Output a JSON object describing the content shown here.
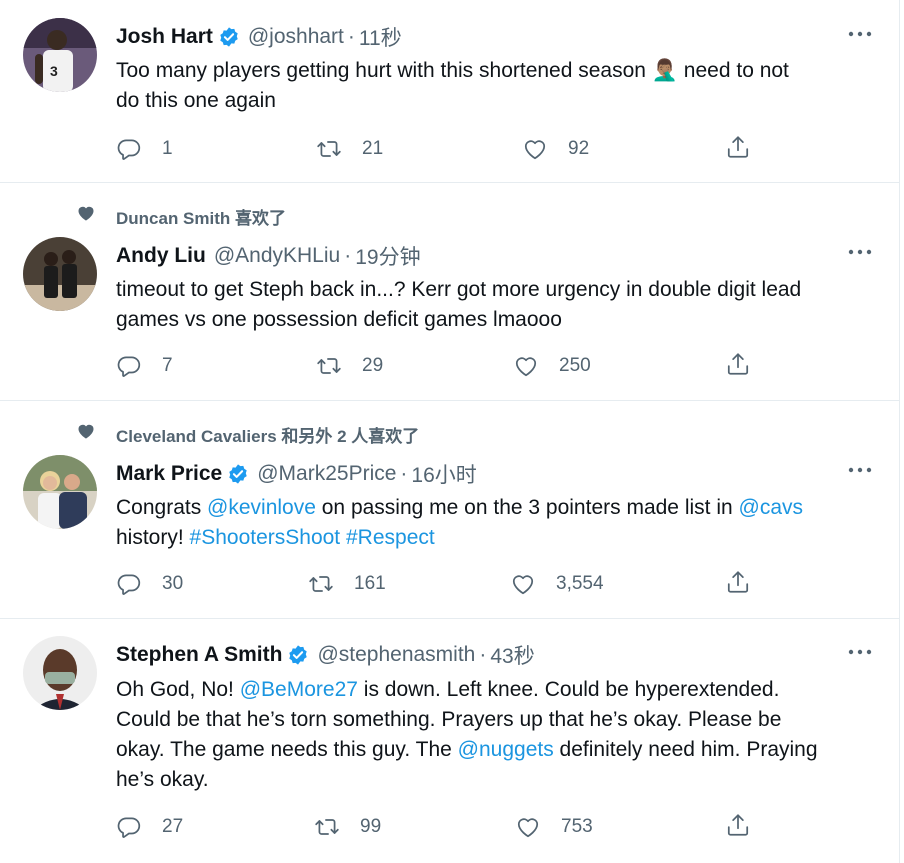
{
  "tweets": [
    {
      "name": "Josh Hart",
      "verified": true,
      "handle": "@joshhart",
      "time": "11秒",
      "social_context": "",
      "body_line1": "Too many players getting hurt with this shortened season ",
      "emoji": "🤦🏽‍♂️",
      "body_line1_end": " need to not",
      "body_line2": "do this one again",
      "replies": "1",
      "retweets": "21",
      "likes": "92"
    },
    {
      "name": "Andy Liu",
      "verified": false,
      "handle": "@AndyKHLiu",
      "time": "19分钟",
      "social_context": "Duncan Smith 喜欢了",
      "body_line1": "timeout to get Steph back in...? Kerr got more urgency in double digit lead",
      "body_line2": "games vs one possession deficit games lmaooo",
      "replies": "7",
      "retweets": "29",
      "likes": "250"
    },
    {
      "name": "Mark Price",
      "verified": true,
      "handle": "@Mark25Price",
      "time": "16小时",
      "social_context": "Cleveland Cavaliers 和另外 2 人喜欢了",
      "body_a": "Congrats ",
      "mention1": "@kevinlove",
      "body_b": " on passing me on the 3 pointers made list in ",
      "mention2": "@cavs",
      "body_c": "history! ",
      "hashtag1": "#ShootersShoot",
      "hashtag2": "#Respect",
      "replies": "30",
      "retweets": "161",
      "likes": "3,554"
    },
    {
      "name": "Stephen A Smith",
      "verified": true,
      "handle": "@stephenasmith",
      "time": "43秒",
      "social_context": "",
      "body_a": "Oh God, No! ",
      "mention1": "@BeMore27",
      "body_b": " is down. Left knee. Could be hyperextended.",
      "body_line2": "Could be that he’s torn something. Prayers up that he’s okay. Please be",
      "body_c": "okay. The game needs this guy. The ",
      "mention2": "@nuggets",
      "body_d": " definitely need him. Praying",
      "body_line4": "he’s okay.",
      "replies": "27",
      "retweets": "99",
      "likes": "753"
    }
  ],
  "sep": "·",
  "colors": {
    "link": "#1b95e0",
    "muted": "#536471",
    "verified": "#1d9bf0",
    "border": "#e6ecf0"
  }
}
